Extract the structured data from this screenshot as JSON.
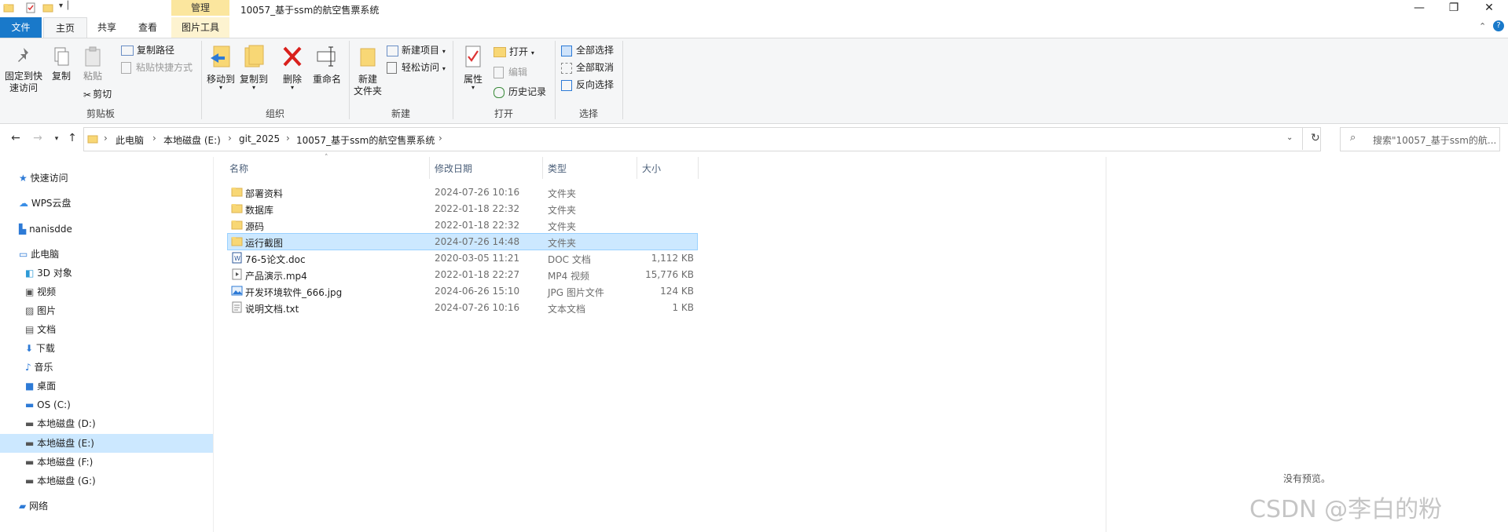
{
  "window": {
    "title": "10057_基于ssm的航空售票系统",
    "context_tab": "管理",
    "controls": [
      "—",
      "❐",
      "✕"
    ]
  },
  "tabs": {
    "file": "文件",
    "home": "主页",
    "share": "共享",
    "view": "查看",
    "picture_tools": "图片工具"
  },
  "ribbon": {
    "clipboard": {
      "pin": "固定到快\n速访问",
      "copy": "复制",
      "paste": "粘贴",
      "copy_path": "复制路径",
      "paste_shortcut": "粘贴快捷方式",
      "cut": "剪切",
      "label": "剪贴板"
    },
    "organize": {
      "move_to": "移动到",
      "copy_to": "复制到",
      "delete": "删除",
      "rename": "重命名",
      "label": "组织"
    },
    "new": {
      "new_folder": "新建\n文件夹",
      "new_item": "新建项目",
      "easy_access": "轻松访问",
      "label": "新建"
    },
    "open": {
      "properties": "属性",
      "open": "打开",
      "edit": "编辑",
      "history": "历史记录",
      "label": "打开"
    },
    "select": {
      "select_all": "全部选择",
      "select_none": "全部取消",
      "invert": "反向选择",
      "label": "选择"
    }
  },
  "address": {
    "crumbs": [
      "此电脑",
      "本地磁盘 (E:)",
      "git_2025",
      "10057_基于ssm的航空售票系统"
    ],
    "search_placeholder": "搜索\"10057_基于ssm的航..."
  },
  "nav": {
    "quick_access": "快速访问",
    "wps_cloud": "WPS云盘",
    "user": "nanisdde",
    "this_pc": "此电脑",
    "items": [
      "3D 对象",
      "视频",
      "图片",
      "文档",
      "下载",
      "音乐",
      "桌面",
      "OS (C:)",
      "本地磁盘 (D:)",
      "本地磁盘 (E:)",
      "本地磁盘 (F:)",
      "本地磁盘 (G:)"
    ],
    "network": "网络"
  },
  "columns": {
    "name": "名称",
    "date": "修改日期",
    "type": "类型",
    "size": "大小"
  },
  "files": [
    {
      "name": "部署资料",
      "date": "2024-07-26 10:16",
      "type": "文件夹",
      "size": "",
      "icon": "folder-icon"
    },
    {
      "name": "数据库",
      "date": "2022-01-18 22:32",
      "type": "文件夹",
      "size": "",
      "icon": "folder-icon"
    },
    {
      "name": "源码",
      "date": "2022-01-18 22:32",
      "type": "文件夹",
      "size": "",
      "icon": "folder-icon"
    },
    {
      "name": "运行截图",
      "date": "2024-07-26 14:48",
      "type": "文件夹",
      "size": "",
      "icon": "folder-icon"
    },
    {
      "name": "76-5论文.doc",
      "date": "2020-03-05 11:21",
      "type": "DOC 文档",
      "size": "1,112 KB",
      "icon": "word-doc-icon"
    },
    {
      "name": "产品演示.mp4",
      "date": "2022-01-18 22:27",
      "type": "MP4 视频",
      "size": "15,776 KB",
      "icon": "video-file-icon"
    },
    {
      "name": "开发环境软件_666.jpg",
      "date": "2024-06-26 15:10",
      "type": "JPG 图片文件",
      "size": "124 KB",
      "icon": "image-file-icon"
    },
    {
      "name": "说明文档.txt",
      "date": "2024-07-26 10:16",
      "type": "文本文档",
      "size": "1 KB",
      "icon": "text-file-icon"
    }
  ],
  "selected_row": 3,
  "preview": {
    "empty_text": "没有预览。"
  },
  "watermark": "CSDN @李白的粉",
  "colors": {
    "accent": "#1979ca",
    "selection": "#cce8ff",
    "context_tab": "#fbe69e"
  }
}
